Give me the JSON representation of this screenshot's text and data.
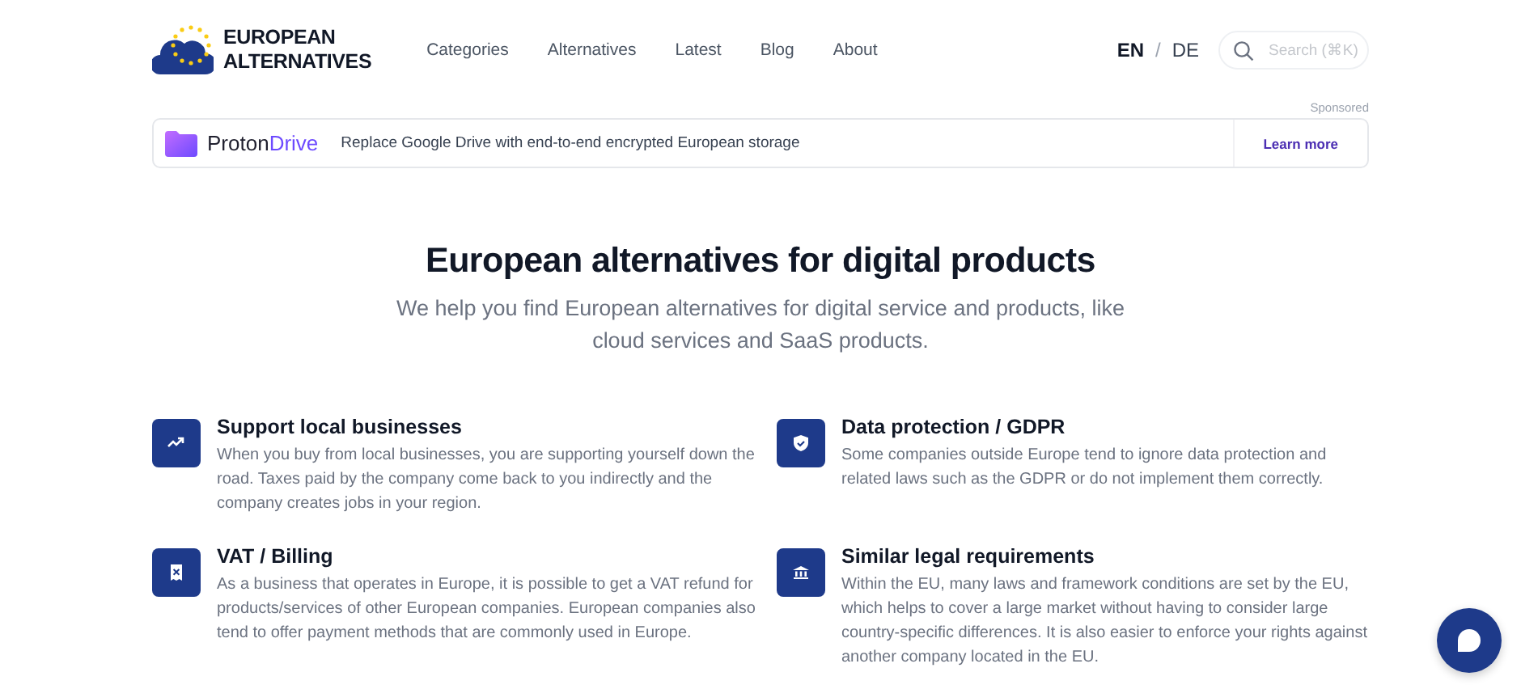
{
  "header": {
    "logo": [
      "EUROPEAN",
      "ALTERNATIVES"
    ],
    "nav": [
      {
        "label": "Categories"
      },
      {
        "label": "Alternatives"
      },
      {
        "label": "Latest"
      },
      {
        "label": "Blog"
      },
      {
        "label": "About"
      }
    ],
    "languages": [
      {
        "label": "EN",
        "selected": true
      },
      {
        "label": "DE",
        "selected": false
      }
    ],
    "language_separator": "/",
    "search": {
      "placeholder": "Search (⌘K)"
    }
  },
  "ad": {
    "label": "Sponsored",
    "brand": "Proton",
    "product": "Drive",
    "text": "Replace Google Drive with end-to-end encrypted European storage",
    "link": "Learn more"
  },
  "hero": {
    "title": "European alternatives for digital products",
    "subtitle": "We help you find European alternatives for digital service and products, like cloud services and SaaS products."
  },
  "features": [
    {
      "title": "Support local businesses",
      "text": "When you buy from local businesses, you are supporting yourself down the road. Taxes paid by the company come back to you indirectly and the company creates jobs in your region."
    },
    {
      "title": "Data protection / GDPR",
      "text": "Some companies outside Europe tend to ignore data protection and related laws such as the GDPR or do not implement them correctly."
    },
    {
      "title": "VAT / Billing",
      "text": "As a business that operates in Europe, it is possible to get a VAT refund for products/services of other European companies. European companies also tend to offer payment methods that are commonly used in Europe."
    },
    {
      "title": "Similar legal requirements",
      "text": "Within the EU, many laws and framework conditions are set by the EU, which helps to cover a large market without having to consider large country-specific differences. It is also easier to enforce your rights against another company located in the EU."
    }
  ]
}
